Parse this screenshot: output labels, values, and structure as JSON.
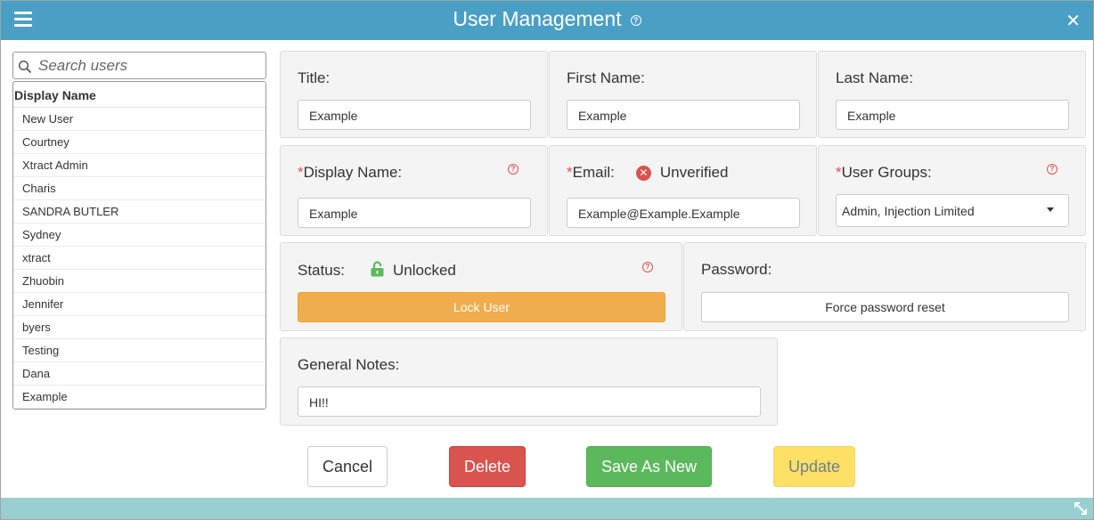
{
  "window": {
    "title": "User Management"
  },
  "search": {
    "placeholder": "Search users"
  },
  "userlist": {
    "header": "Display Name",
    "users": [
      "New User",
      "Courtney",
      "Xtract Admin",
      "Charis",
      "SANDRA BUTLER",
      "Sydney",
      "xtract",
      "Zhuobin",
      "Jennifer",
      "byers",
      "Testing",
      "Dana",
      "Example"
    ]
  },
  "form": {
    "title": {
      "label": "Title:",
      "value": "Example"
    },
    "first_name": {
      "label": "First Name:",
      "value": "Example"
    },
    "last_name": {
      "label": "Last Name:",
      "value": "Example"
    },
    "display_name": {
      "required": "*",
      "label": "Display Name:",
      "value": "Example"
    },
    "email": {
      "required": "*",
      "label": "Email:",
      "status": "Unverified",
      "value": "Example@Example.Example"
    },
    "user_groups": {
      "required": "*",
      "label": "User Groups:",
      "value": "Admin, Injection Limited"
    },
    "status": {
      "label": "Status:",
      "value": "Unlocked",
      "button": "Lock User"
    },
    "password": {
      "label": "Password:",
      "button": "Force password reset"
    },
    "notes": {
      "label": "General Notes:",
      "value": "HI!!"
    }
  },
  "actions": {
    "cancel": "Cancel",
    "delete": "Delete",
    "save_as_new": "Save As New",
    "update": "Update"
  },
  "colors": {
    "titlebar": "#4a9fc5",
    "warning": "#f0ad4e",
    "danger": "#d9534f",
    "success": "#5cb85c",
    "update": "#ffe066",
    "unlocked": "#5cb85c",
    "bottombar": "#99cfd0"
  },
  "icons": [
    "menu-icon",
    "help-icon",
    "close-icon",
    "search-icon",
    "error-icon",
    "unlock-icon",
    "resize-icon",
    "dropdown-caret-icon"
  ]
}
